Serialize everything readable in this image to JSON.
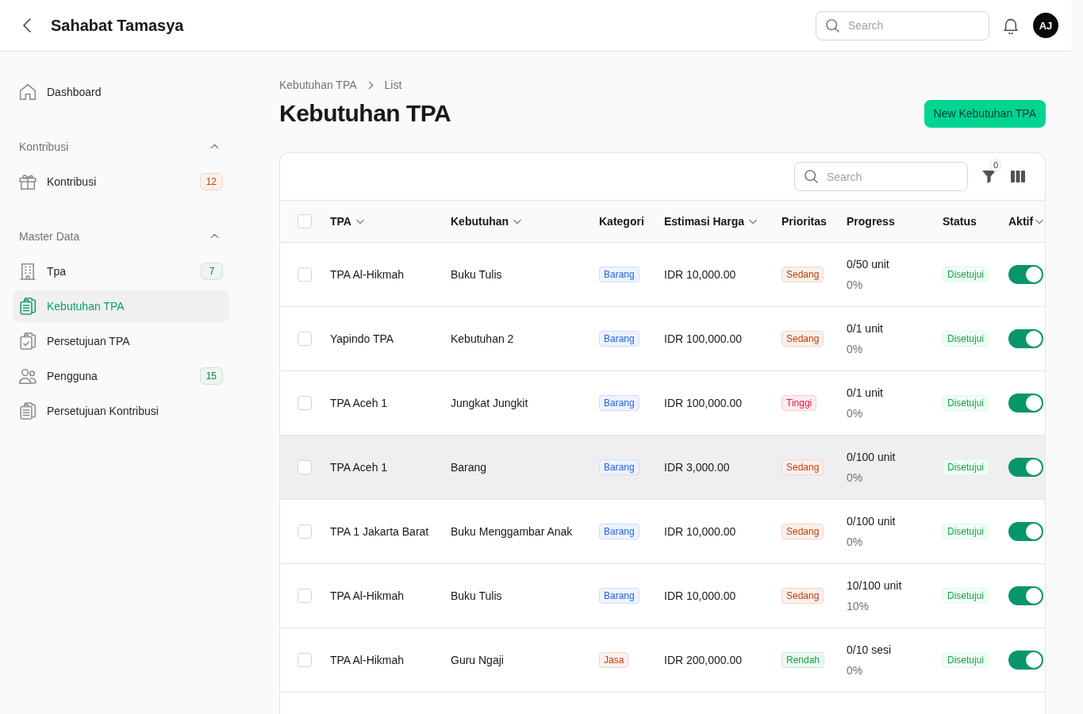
{
  "header": {
    "title": "Sahabat Tamasya",
    "search": {
      "placeholder": "Search"
    },
    "avatar": "AJ"
  },
  "sidebar": {
    "sections": [
      {
        "items": [
          {
            "label": "Dashboard",
            "selected": false
          }
        ]
      },
      {
        "label": "Kontribusi",
        "expanded": true,
        "items": [
          {
            "label": "Kontribusi",
            "selected": false,
            "badge": {
              "text": "12",
              "color": "#c2410c"
            }
          }
        ]
      },
      {
        "label": "Master Data",
        "expanded": true,
        "items": [
          {
            "label": "Tpa",
            "selected": false,
            "badge": {
              "text": "7",
              "color": "#15803d"
            }
          },
          {
            "label": "Kebutuhan TPA",
            "selected": true
          },
          {
            "label": "Persetujuan TPA",
            "selected": false
          },
          {
            "label": "Pengguna",
            "selected": false,
            "badge": {
              "text": "15",
              "color": "#15803d"
            }
          },
          {
            "label": "Persetujuan Kontribusi",
            "selected": false
          }
        ]
      }
    ]
  },
  "page": {
    "breadcrumbs": [
      "Kebutuhan TPA",
      "List"
    ],
    "title": "Kebutuhan TPA",
    "create_button": "New Kebutuhan TPA"
  },
  "table": {
    "search": {
      "placeholder": "Search"
    },
    "filter_count": "0",
    "select_all": {
      "checked": false
    },
    "columns": [
      {
        "label": "TPA",
        "sortable": true
      },
      {
        "label": "Kebutuhan",
        "sortable": true
      },
      {
        "label": "Kategori",
        "sortable": false
      },
      {
        "label": "Estimasi Harga",
        "sortable": true
      },
      {
        "label": "Prioritas",
        "sortable": false
      },
      {
        "label": "Progress",
        "sortable": false
      },
      {
        "label": "Status",
        "sortable": false
      },
      {
        "label": "Aktif",
        "sortable": true
      }
    ],
    "rows": [
      {
        "checked": false,
        "highlighted": false,
        "tpa": "TPA Al-Hikmah",
        "kebutuhan": "Buku Tulis",
        "kategori": {
          "text": "Barang",
          "color": "#2563eb"
        },
        "harga": "IDR 10,000.00",
        "prioritas": {
          "text": "Sedang",
          "color": "#c2410c"
        },
        "progress": "0/50 unit",
        "percent": "0%",
        "status": "Disetujui",
        "aktif": true
      },
      {
        "checked": false,
        "highlighted": false,
        "tpa": "Yapindo TPA",
        "kebutuhan": "Kebutuhan 2",
        "kategori": {
          "text": "Barang",
          "color": "#2563eb"
        },
        "harga": "IDR 100,000.00",
        "prioritas": {
          "text": "Sedang",
          "color": "#c2410c"
        },
        "progress": "0/1 unit",
        "percent": "0%",
        "status": "Disetujui",
        "aktif": true
      },
      {
        "checked": false,
        "highlighted": false,
        "tpa": "TPA Aceh 1",
        "kebutuhan": "Jungkat Jungkit",
        "kategori": {
          "text": "Barang",
          "color": "#2563eb"
        },
        "harga": "IDR 100,000.00",
        "prioritas": {
          "text": "Tinggi",
          "color": "#e11d48"
        },
        "progress": "0/1 unit",
        "percent": "0%",
        "status": "Disetujui",
        "aktif": true
      },
      {
        "checked": false,
        "highlighted": true,
        "tpa": "TPA Aceh 1",
        "kebutuhan": "Barang",
        "kategori": {
          "text": "Barang",
          "color": "#2563eb"
        },
        "harga": "IDR 3,000.00",
        "prioritas": {
          "text": "Sedang",
          "color": "#c2410c"
        },
        "progress": "0/100 unit",
        "percent": "0%",
        "status": "Disetujui",
        "aktif": true
      },
      {
        "checked": false,
        "highlighted": false,
        "tpa": "TPA 1 Jakarta Barat",
        "kebutuhan": "Buku Menggambar Anak",
        "kategori": {
          "text": "Barang",
          "color": "#2563eb"
        },
        "harga": "IDR 10,000.00",
        "prioritas": {
          "text": "Sedang",
          "color": "#c2410c"
        },
        "progress": "0/100 unit",
        "percent": "0%",
        "status": "Disetujui",
        "aktif": true
      },
      {
        "checked": false,
        "highlighted": false,
        "tpa": "TPA Al-Hikmah",
        "kebutuhan": "Buku Tulis",
        "kategori": {
          "text": "Barang",
          "color": "#2563eb"
        },
        "harga": "IDR 10,000.00",
        "prioritas": {
          "text": "Sedang",
          "color": "#c2410c"
        },
        "progress": "10/100 unit",
        "percent": "10%",
        "status": "Disetujui",
        "aktif": true
      },
      {
        "checked": false,
        "highlighted": false,
        "tpa": "TPA Al-Hikmah",
        "kebutuhan": "Guru Ngaji",
        "kategori": {
          "text": "Jasa",
          "color": "#c2410c"
        },
        "harga": "IDR 200,000.00",
        "prioritas": {
          "text": "Rendah",
          "color": "#16a34a"
        },
        "progress": "0/10 sesi",
        "percent": "0%",
        "status": "Disetujui",
        "aktif": true
      }
    ]
  }
}
